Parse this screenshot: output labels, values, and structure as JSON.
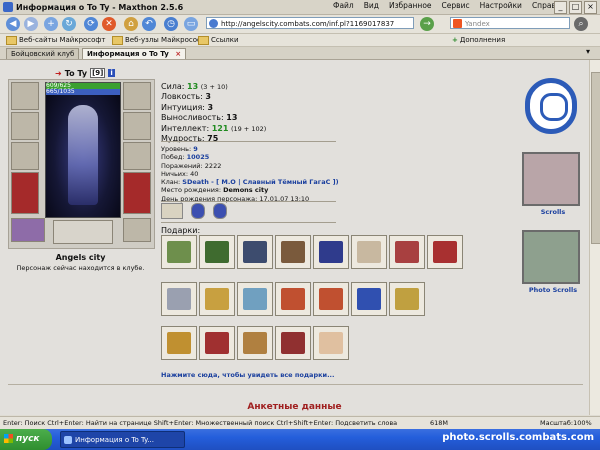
{
  "window": {
    "title": "Информация о To Ty - Maxthon 2.5.6",
    "menu": [
      "Файл",
      "Вид",
      "Избранное",
      "Сервис",
      "Настройки",
      "Справка"
    ]
  },
  "navbar": {
    "address": "http://angelscity.combats.com/inf.pl?1169017837",
    "search_placeholder": "Yandex"
  },
  "favorites": {
    "items": [
      "Веб-сайты Майкрософт",
      "Веб-узлы Майкрософт",
      "Ссылки"
    ],
    "addons": "Дополнения"
  },
  "tabs": [
    {
      "label": "Бойцовский клуб"
    },
    {
      "label": "Информация о To Ty"
    }
  ],
  "character": {
    "name": "To Ty",
    "level": "[9]",
    "info": "i",
    "hp": "609/625",
    "mp": "665/1035",
    "city": "Angels city",
    "status": "Персонаж сейчас находится в клубе."
  },
  "stats": {
    "strength": {
      "label": "Сила:",
      "value": "13",
      "extra": "(3 + 10)"
    },
    "agility": {
      "label": "Ловкость:",
      "value": "3"
    },
    "intuition": {
      "label": "Интуиция:",
      "value": "3"
    },
    "endurance": {
      "label": "Выносливость:",
      "value": "13"
    },
    "intellect": {
      "label": "Интеллект:",
      "value": "121",
      "extra": "(19 + 102)"
    },
    "wisdom": {
      "label": "Мудрость:",
      "value": "75"
    }
  },
  "details": {
    "level": {
      "label": "Уровень:",
      "value": "9"
    },
    "wins": {
      "label": "Побед:",
      "value": "10025"
    },
    "losses": {
      "label": "Поражений:",
      "value": "2222"
    },
    "draws": {
      "label": "Ничьих:",
      "value": "40"
    },
    "clan": {
      "label": "Клан:",
      "value": "SDeath - [ М.О | Славный Тёмный ГагаС ])"
    },
    "birthplace": {
      "label": "Место рождения:",
      "value": "Demons city"
    },
    "birthday": {
      "label": "День рождения персонажа:",
      "value": "17.01.07 13:10"
    }
  },
  "gifts": {
    "label": "Подарки:",
    "link": "Нажмите сюда, чтобы увидеть все подарки...",
    "colors": [
      "#6e8f4c",
      "#3f6b2f",
      "#3d4c6e",
      "#7a5a3c",
      "#2f3b8c",
      "#c8b8a0",
      "#a84040",
      "#a83030",
      "#9aa0b0",
      "#c8a040",
      "#70a0c0",
      "#c05030",
      "#c05030",
      "#3050b0",
      "#c0a040",
      "#c09030",
      "#a03030",
      "#b08040",
      "#903030",
      "#e0c0a0"
    ]
  },
  "right": {
    "scrolls": "Scrolls",
    "photo_scrolls": "Photo Scrolls"
  },
  "section_title": "Анкетные данные",
  "statusbar": {
    "hint": "Enter: Поиск Ctrl+Enter: Найти на странице Shift+Enter: Множественный поиск Ctrl+Shift+Enter: Подсветить слова",
    "memory": "618M",
    "zoom": "Масштаб:100%"
  },
  "taskbar": {
    "start": "пуск",
    "task": "Информация о To Ty...",
    "watermark": "photo.scrolls.combats.com"
  }
}
